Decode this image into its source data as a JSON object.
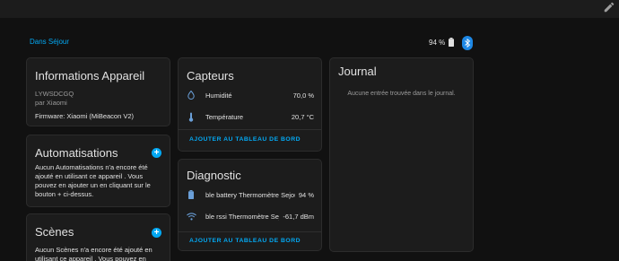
{
  "breadcrumb": "Dans Séjour",
  "battery": {
    "value": "94 %"
  },
  "info": {
    "title": "Informations Appareil",
    "model": "LYWSDCGQ",
    "manufacturer": "par Xiaomi",
    "firmware": "Firmware: Xiaomi (MiBeacon V2)"
  },
  "automations": {
    "title": "Automatisations",
    "text": "Aucun Automatisations n'a encore été ajouté en utilisant ce appareil . Vous pouvez en ajouter un en cliquant sur le bouton + ci-dessus."
  },
  "scenes": {
    "title": "Scènes",
    "text": "Aucun Scènes n'a encore été ajouté en utilisant ce appareil . Vous pouvez en ajouter"
  },
  "sensors": {
    "title": "Capteurs",
    "rows": [
      {
        "label": "Humidité",
        "value": "70,0 %",
        "icon": "water-drop-icon"
      },
      {
        "label": "Température",
        "value": "20,7 °C",
        "icon": "thermometer-icon"
      }
    ],
    "action": "AJOUTER AU TABLEAU DE BORD"
  },
  "diagnostic": {
    "title": "Diagnostic",
    "rows": [
      {
        "label": "ble battery Thermomètre Sejour",
        "value": "94 %",
        "icon": "battery-icon"
      },
      {
        "label": "ble rssi Thermomètre Sej...",
        "value": "-61,7 dBm",
        "icon": "wifi-icon"
      }
    ],
    "action": "AJOUTER AU TABLEAU DE BORD"
  },
  "journal": {
    "title": "Journal",
    "empty": "Aucune entrée trouvée dans le journal."
  },
  "colors": {
    "accent": "#03a9f4",
    "card": "#1c1c1c",
    "background": "#111111",
    "bluetooth": "#1e88e5"
  }
}
